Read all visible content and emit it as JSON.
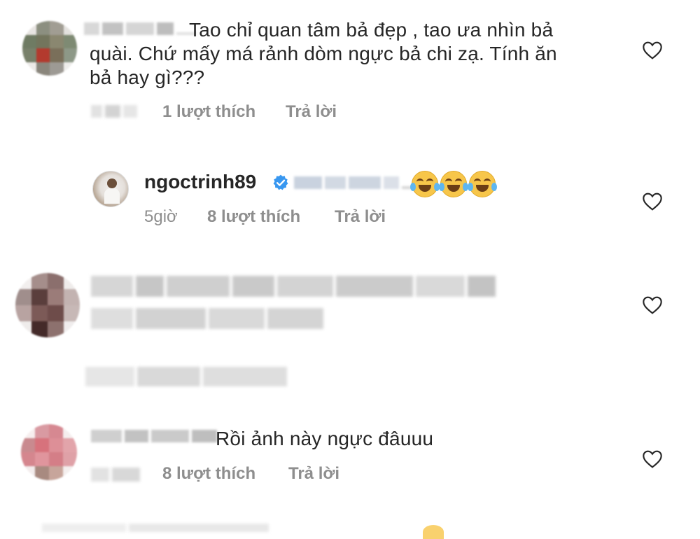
{
  "comments": [
    {
      "text_line1": "Tao chỉ quan tâm bả đẹp , tao ưa nhìn bả",
      "text_line2": "quài. Chứ mấy má rảnh dòm ngực bả chi zạ. Tính ăn",
      "text_line3": "bả hay gì???",
      "likes": "1 lượt thích",
      "reply": "Trả lời"
    },
    {
      "username": "ngoctrinh89",
      "time": "5giờ",
      "likes": "8 lượt thích",
      "reply": "Trả lời",
      "emoji_name": "joy-emoji"
    },
    {
      "text": "Rồi ảnh này ngực đâuuu",
      "likes": "8 lượt thích",
      "reply": "Trả lời"
    }
  ],
  "colors": {
    "text": "#262626",
    "meta": "#8e8e8e",
    "verified": "#3897f0"
  }
}
